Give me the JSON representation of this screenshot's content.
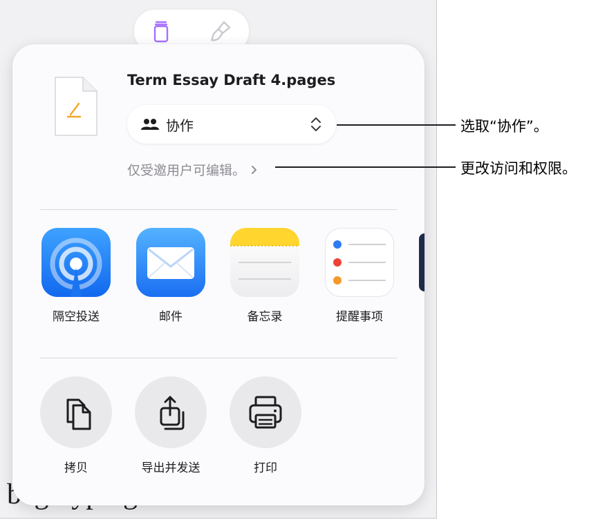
{
  "document": {
    "visible_text": "beginyping"
  },
  "toolbar": {
    "tabs": [
      {
        "icon": "document-format-icon"
      },
      {
        "icon": "paintbrush-icon"
      }
    ]
  },
  "share_sheet": {
    "file": {
      "name": "Term Essay Draft 4.pages",
      "icon": "pages-document-icon"
    },
    "collaboration": {
      "label": "协作",
      "icon": "people-icon",
      "chevron": "chevron-up-down-icon"
    },
    "access_summary": "仅受邀用户可编辑。",
    "apps": [
      {
        "label": "隔空投送",
        "icon": "airdrop-icon"
      },
      {
        "label": "邮件",
        "icon": "mail-icon"
      },
      {
        "label": "备忘录",
        "icon": "notes-icon"
      },
      {
        "label": "提醒事项",
        "icon": "reminders-icon"
      }
    ],
    "actions": [
      {
        "label": "拷贝",
        "icon": "copy-icon"
      },
      {
        "label": "导出并发送",
        "icon": "export-icon"
      },
      {
        "label": "打印",
        "icon": "printer-icon"
      }
    ]
  },
  "callouts": [
    {
      "text": "选取“协作”。"
    },
    {
      "text": "更改访问和权限。"
    }
  ],
  "colors": {
    "pages_orange": "#f5a623",
    "airdrop_blue": "#1a7cf5",
    "mail_blue": "#2c8cf9",
    "notes_yellow": "#ffd52e",
    "toolbar_purple": "#a670ff"
  }
}
